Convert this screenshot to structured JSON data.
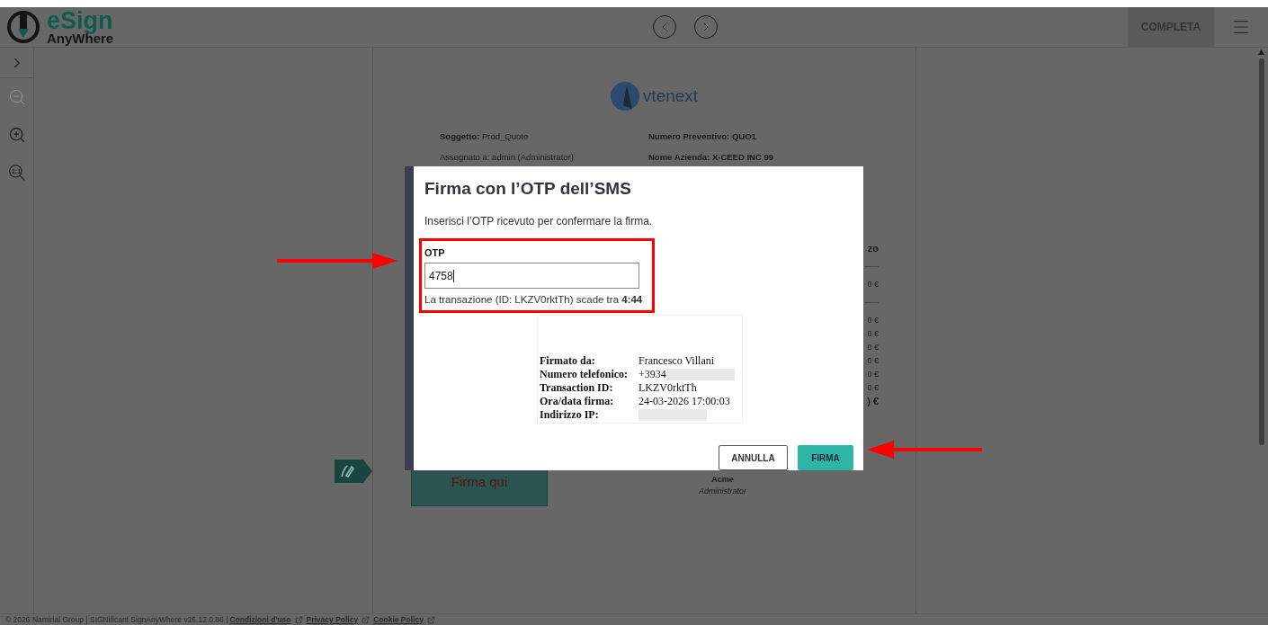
{
  "header": {
    "logo": {
      "title": "eSign",
      "subtitle": "AnyWhere"
    },
    "complete_button": "COMPLETA"
  },
  "tools": [
    {
      "kind": "expand",
      "disabled": false
    },
    {
      "kind": "zoom_out",
      "disabled": true
    },
    {
      "kind": "zoom_in",
      "disabled": false
    },
    {
      "kind": "zoom_reset",
      "label": "1:1",
      "disabled": false
    }
  ],
  "document": {
    "logo_text": "vtenext",
    "fields": [
      {
        "text": "**Soggetto:** Prod_Quote",
        "bold": false
      },
      {
        "text": "Numero Preventivo: QUO1",
        "bold": true
      },
      {
        "text": "Assegnato a: admin (Administrator)",
        "bold": false
      },
      {
        "text": "Nome Azienda: X-CEED INC 99",
        "bold": true
      }
    ],
    "fragments": [
      {
        "kind": "text",
        "text": "zo",
        "bold": true
      },
      {
        "kind": "rule"
      },
      {
        "kind": "text",
        "text": "0 €",
        "bold": false
      },
      {
        "kind": "rule"
      },
      {
        "kind": "text",
        "text": "0 €",
        "bold": false
      },
      {
        "kind": "text",
        "text": "0 €",
        "bold": false
      },
      {
        "kind": "text",
        "text": "0 €",
        "bold": false
      },
      {
        "kind": "text",
        "text": "0 €",
        "bold": false
      },
      {
        "kind": "text",
        "text": "0 €",
        "bold": false
      },
      {
        "kind": "text",
        "text": "0 €",
        "bold": false
      },
      {
        "kind": "text",
        "text": ") €",
        "bold": true
      }
    ],
    "signature_box": "Firma qui",
    "signer_company": "Acme",
    "signer_role": "Administrator"
  },
  "modal": {
    "title": "Firma con l’OTP dell’SMS",
    "description": "Inserisci l’OTP ricevuto per confermare la firma.",
    "otp_label": "OTP",
    "otp_value": "4758",
    "expiry": "La transazione (ID: LKZV0rktTh) scade tra **4:44**",
    "stamp": [
      {
        "label": "Firmato da:",
        "value": "Francesco Villani",
        "redacted": false
      },
      {
        "label": "Numero telefonico:",
        "value": "+3934",
        "redacted": true
      },
      {
        "label": "Transaction ID:",
        "value": "LKZV0rktTh",
        "redacted": false
      },
      {
        "label": "Ora/data firma:",
        "value": "24-03-2026 17:00:03",
        "redacted": false
      },
      {
        "label": "Indirizzo IP:",
        "redacted": true
      }
    ],
    "cancel_button": "ANNULLA",
    "confirm_button": "FIRMA"
  },
  "footer": {
    "copyright": "© 2026 Namirial Group | SIGNificant SignAnyWhere v26.12.0.86 |",
    "links": [
      "Condizioni d'uso",
      "Privacy Policy",
      "Cookie Policy"
    ]
  }
}
